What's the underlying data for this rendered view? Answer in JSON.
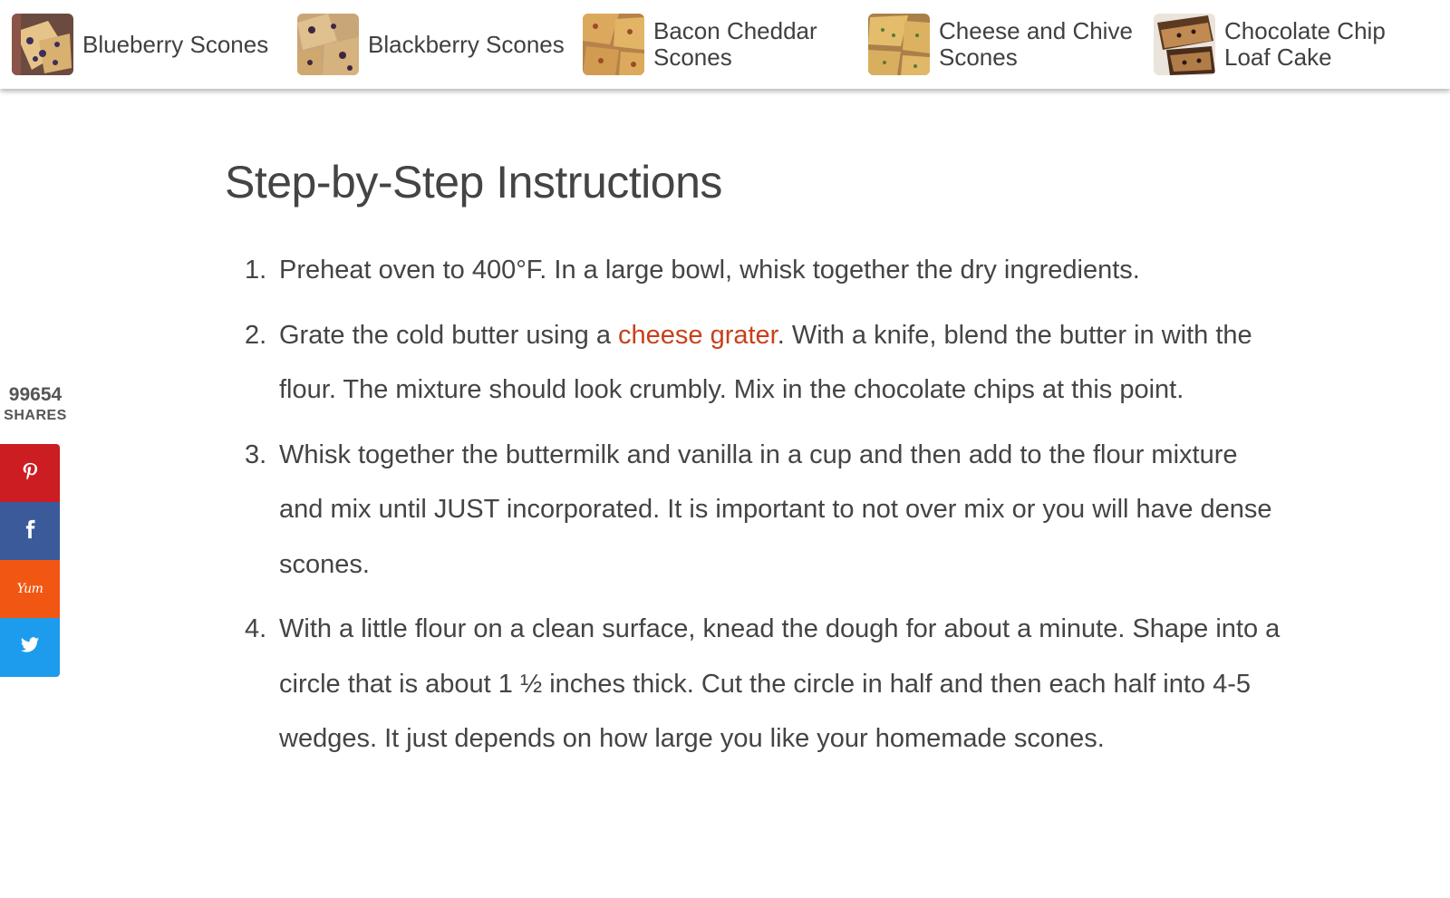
{
  "related_posts": [
    {
      "label": "Blueberry Scones",
      "icon": "blueberry-scones-thumbnail"
    },
    {
      "label": "Blackberry Scones",
      "icon": "blackberry-scones-thumbnail"
    },
    {
      "label": "Bacon Cheddar Scones",
      "icon": "bacon-cheddar-scones-thumbnail"
    },
    {
      "label": "Cheese and Chive Scones",
      "icon": "cheese-chive-scones-thumbnail"
    },
    {
      "label": "Chocolate Chip Loaf Cake",
      "icon": "chocolate-chip-loaf-thumbnail"
    }
  ],
  "share": {
    "count": "99654",
    "label": "SHARES",
    "buttons": [
      {
        "network": "pinterest",
        "icon": "pinterest-icon",
        "color": "#cb1d22"
      },
      {
        "network": "facebook",
        "icon": "facebook-icon",
        "color": "#3b5a9a"
      },
      {
        "network": "yummly",
        "icon": "yummly-icon",
        "text": "Yum",
        "color": "#f25613"
      },
      {
        "network": "twitter",
        "icon": "twitter-icon",
        "color": "#1d9cee"
      }
    ]
  },
  "instructions": {
    "heading": "Step-by-Step Instructions",
    "steps": [
      {
        "num": "1.",
        "text": "Preheat oven to 400°F. In a large bowl, whisk together the dry ingredients."
      },
      {
        "num": "2.",
        "before": "Grate the cold butter using a ",
        "link": "cheese grater",
        "after": ". With a knife, blend the butter in with the flour. The mixture should look crumbly. Mix in the chocolate chips at this point."
      },
      {
        "num": "3.",
        "text": "Whisk together the buttermilk and vanilla in a cup and then add to the flour mixture and mix until JUST incorporated. It is important to not over mix or you will have dense scones."
      },
      {
        "num": "4.",
        "text": "With a little flour on a clean surface, knead the dough for about a minute. Shape into a circle that is about 1 ½ inches thick. Cut the circle in half and then each half into 4-5 wedges. It just depends on how large you like your homemade scones."
      }
    ]
  },
  "colors": {
    "link": "#c9401a",
    "text": "#444444"
  }
}
